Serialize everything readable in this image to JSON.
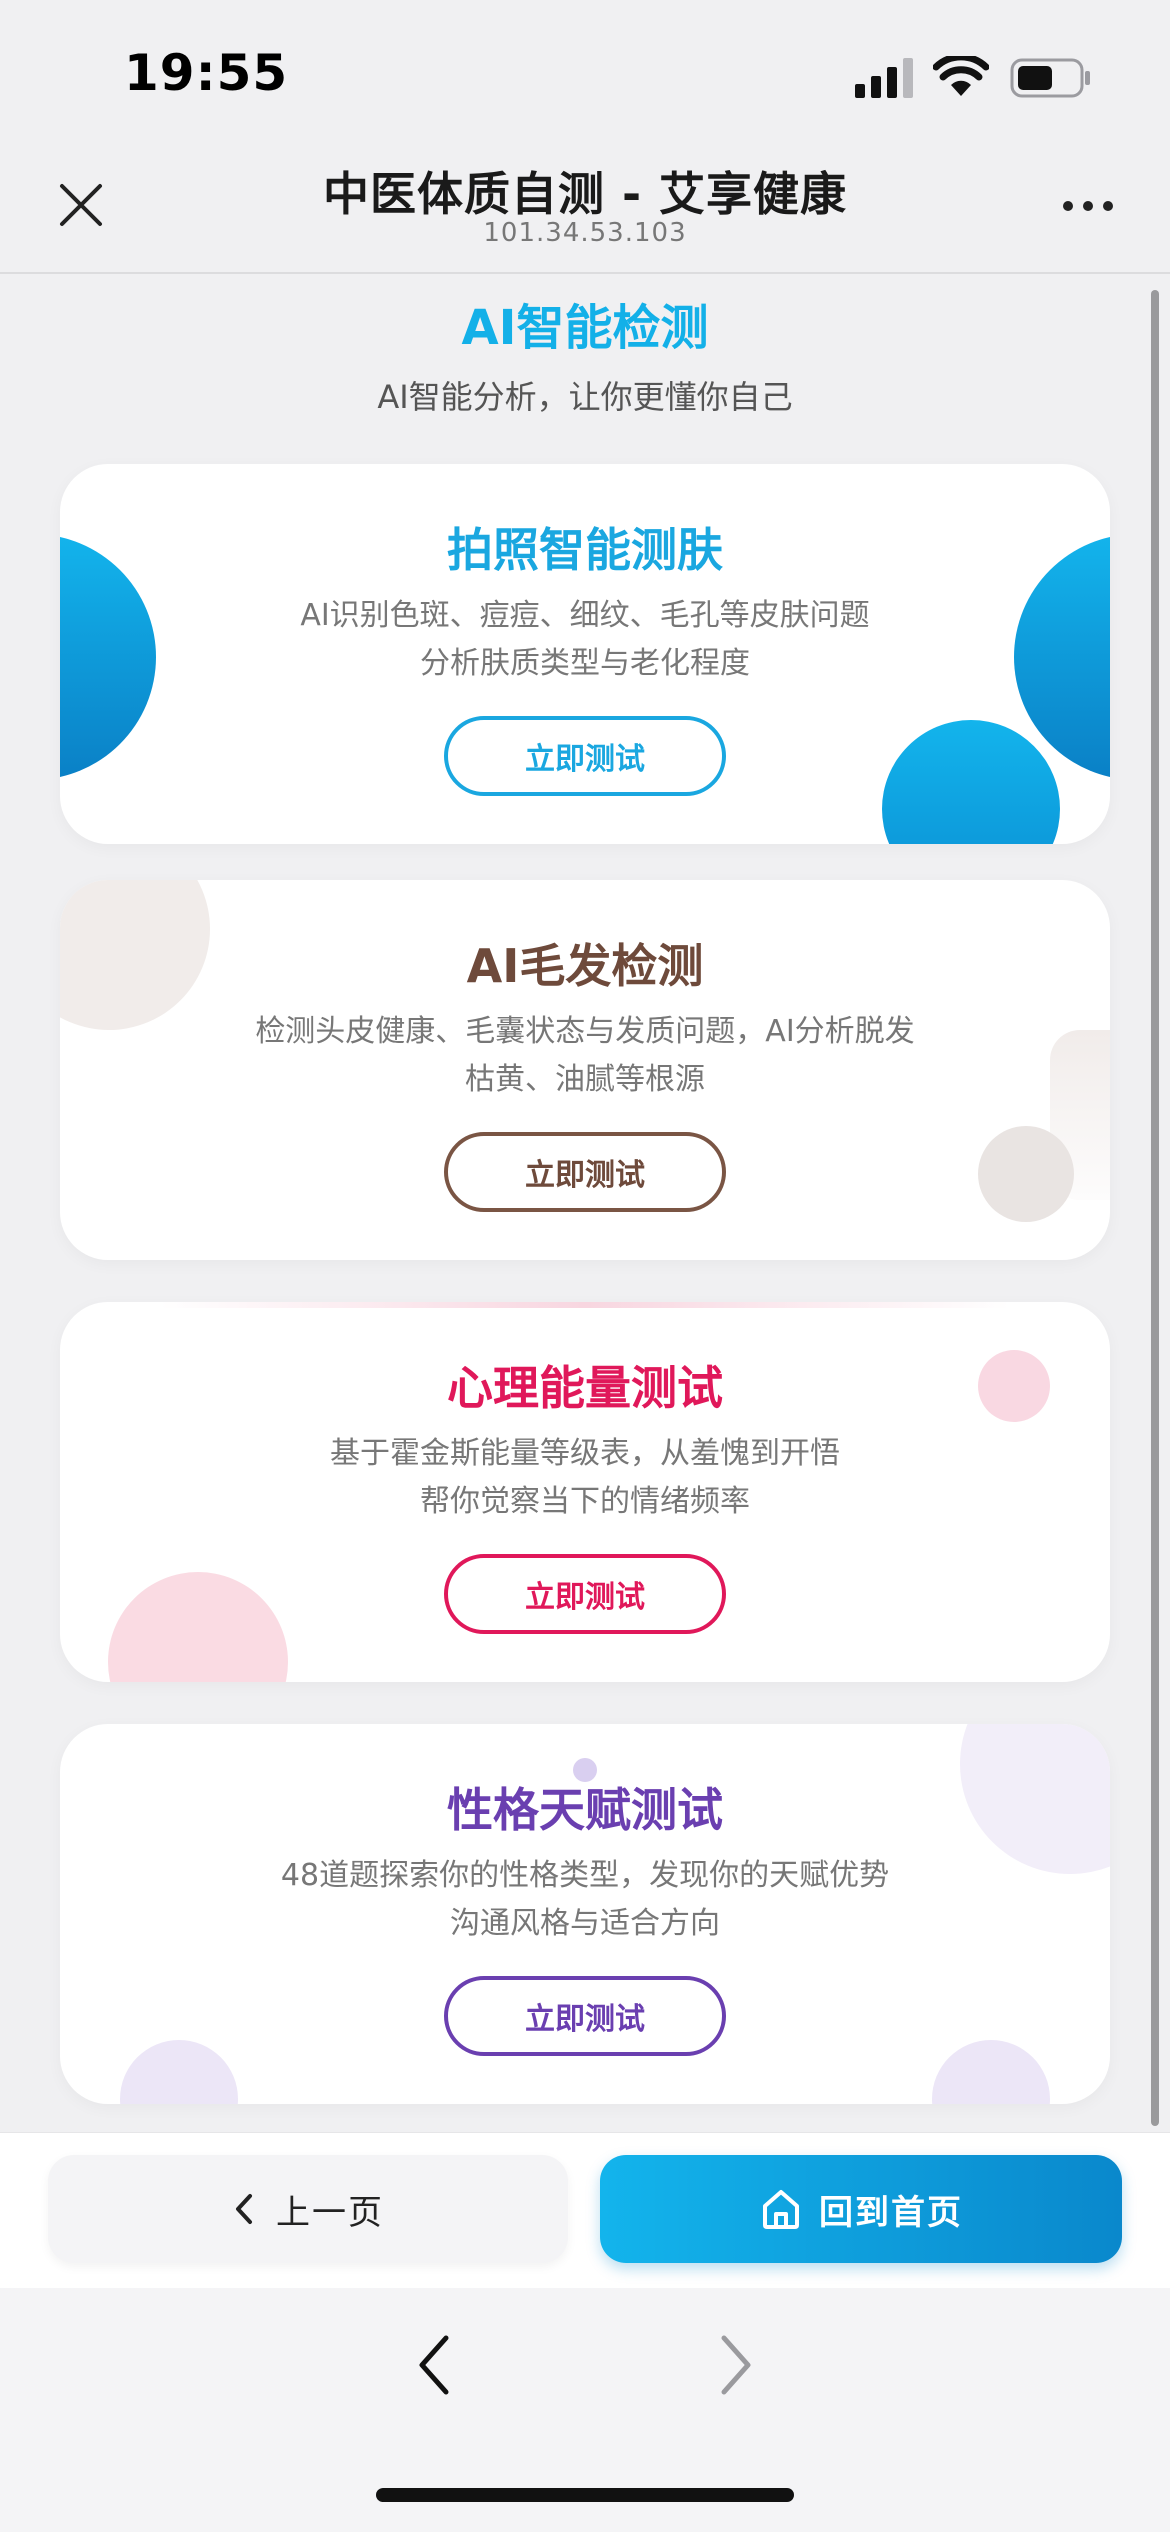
{
  "status_bar": {
    "time": "19:55"
  },
  "header": {
    "title": "中医体质自测 - 艾享健康",
    "subtitle": "101.34.53.103"
  },
  "section": {
    "title": "AI智能检测",
    "subtitle": "AI智能分析，让你更懂你自己"
  },
  "cards": [
    {
      "title": "拍照智能测肤",
      "desc_line1": "AI识别色斑、痘痘、细纹、毛孔等皮肤问题",
      "desc_line2": "分析肤质类型与老化程度",
      "button": "立即测试",
      "color": "#1aa7e0"
    },
    {
      "title": "AI毛发检测",
      "desc_line1": "检测头皮健康、毛囊状态与发质问题，AI分析脱发",
      "desc_line2": "枯黄、油腻等根源",
      "button": "立即测试",
      "color": "#6e4a3b"
    },
    {
      "title": "心理能量测试",
      "desc_line1": "基于霍金斯能量等级表，从羞愧到开悟",
      "desc_line2": "帮你觉察当下的情绪频率",
      "button": "立即测试",
      "color": "#e0185a"
    },
    {
      "title": "性格天赋测试",
      "desc_line1": "48道题探索你的性格类型，发现你的天赋优势",
      "desc_line2": "沟通风格与适合方向",
      "button": "立即测试",
      "color": "#6a3fb0"
    }
  ],
  "action_bar": {
    "prev_label": "上一页",
    "home_label": "回到首页",
    "home_gradient": [
      "#13b4ec",
      "#0a88cc"
    ]
  }
}
